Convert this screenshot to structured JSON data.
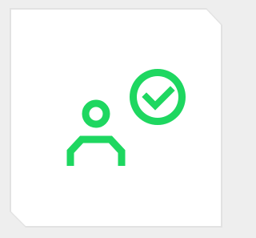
{
  "icon": {
    "name": "user-verified-icon",
    "accent_color": "#1ed760",
    "background_color": "#ffffff",
    "page_background_color": "#eeeeee"
  }
}
